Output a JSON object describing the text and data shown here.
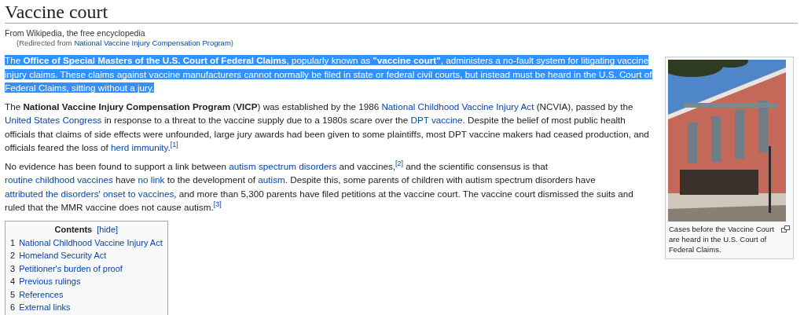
{
  "title": "Vaccine court",
  "tagline": "From Wikipedia, the free encyclopedia",
  "redirect": {
    "prefix": "(Redirected from ",
    "link": "National Vaccine Injury Compensation Program",
    "suffix": ")"
  },
  "paragraphs": [
    {
      "selected": true,
      "segments": [
        {
          "kind": "text",
          "text": "The **Office of Special Masters of the U.S. Court of Federal Claims**, popularly known as **\"vaccine court\"**, administers a no-fault system for litigating vaccine injury claims. These claims against vaccine manufacturers cannot normally be filed in state or federal civil courts, but instead must be heard in the U.S. Court of Federal Claims, sitting without a jury."
        }
      ]
    },
    {
      "selected": false,
      "segments": [
        {
          "kind": "text",
          "text": "The **National Vaccine Injury Compensation Program** (**VICP**) was established by the 1986 "
        },
        {
          "kind": "link",
          "text": "National Childhood Vaccine Injury Act"
        },
        {
          "kind": "text",
          "text": " (NCVIA), passed by the "
        },
        {
          "kind": "link",
          "text": "United States Congress"
        },
        {
          "kind": "text",
          "text": " in response to a threat to the vaccine supply due to a 1980s scare over the "
        },
        {
          "kind": "link",
          "text": "DPT vaccine"
        },
        {
          "kind": "text",
          "text": ". Despite the belief of most public health officials that claims of side effects were unfounded, large jury awards had been given to some plaintiffs, most DPT vaccine makers had ceased production, and officials feared the loss of "
        },
        {
          "kind": "link",
          "text": "herd immunity"
        },
        {
          "kind": "text",
          "text": "."
        },
        {
          "kind": "ref",
          "text": "[1]"
        }
      ]
    },
    {
      "selected": false,
      "segments": [
        {
          "kind": "text",
          "text": "No evidence has been found to support a link between "
        },
        {
          "kind": "link",
          "text": "autism spectrum disorders"
        },
        {
          "kind": "text",
          "text": " and vaccines,"
        },
        {
          "kind": "ref",
          "text": "[2]"
        },
        {
          "kind": "text",
          "text": " and the scientific consensus is that "
        },
        {
          "kind": "link",
          "text": "routine childhood vaccines"
        },
        {
          "kind": "text",
          "text": " have "
        },
        {
          "kind": "link",
          "text": "no link"
        },
        {
          "kind": "text",
          "text": " to the development of "
        },
        {
          "kind": "link",
          "text": "autism"
        },
        {
          "kind": "text",
          "text": ". Despite this, some parents of children with autism spectrum disorders have "
        },
        {
          "kind": "link",
          "text": "attributed the disorders' onset to vaccines"
        },
        {
          "kind": "text",
          "text": ", and more than 5,300 parents have filed petitions at the vaccine court. The vaccine court dismissed the suits and ruled that the MMR vaccine does not cause autism."
        },
        {
          "kind": "ref",
          "text": "[3]"
        }
      ]
    }
  ],
  "contents": {
    "heading": "Contents",
    "toggle": "[hide]",
    "items": [
      {
        "number": "1",
        "label": "National Childhood Vaccine Injury Act"
      },
      {
        "number": "2",
        "label": "Homeland Security Act"
      },
      {
        "number": "3",
        "label": "Petitioner's burden of proof"
      },
      {
        "number": "4",
        "label": "Previous rulings"
      },
      {
        "number": "5",
        "label": "References"
      },
      {
        "number": "6",
        "label": "External links"
      }
    ]
  },
  "infobox": {
    "caption": "Cases before the Vaccine Court are heard in the U.S. Court of Federal Claims."
  }
}
